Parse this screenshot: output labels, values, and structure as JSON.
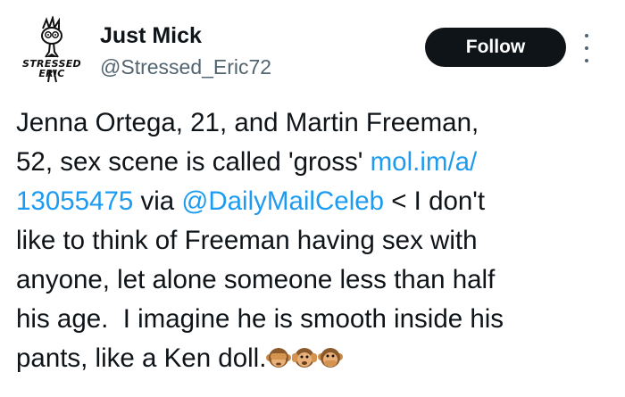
{
  "user": {
    "display_name": "Just Mick",
    "handle": "@Stressed_Eric72",
    "avatar_text_line1": "STRESSED",
    "avatar_text_line2": "ERIC"
  },
  "actions": {
    "follow_label": "Follow"
  },
  "tweet": {
    "segments": [
      {
        "type": "text",
        "value": "Jenna Ortega, 21, and Martin Freeman,\n52, sex scene is called 'gross' "
      },
      {
        "type": "link",
        "value": "mol.im/a/\n13055475"
      },
      {
        "type": "text",
        "value": " via "
      },
      {
        "type": "link",
        "value": "@DailyMailCeleb"
      },
      {
        "type": "text",
        "value": " < I don't\nlike to think of Freeman having sex with\nanyone, let alone someone less than half\nhis age.  I imagine he is smooth inside his\npants, like a Ken doll."
      }
    ],
    "emojis": [
      "see-no-evil-monkey-icon",
      "hear-no-evil-monkey-icon",
      "speak-no-evil-monkey-icon"
    ]
  },
  "colors": {
    "link": "#1d9bf0",
    "handle": "#536471",
    "text": "#0f1419",
    "follow_bg": "#0f1419"
  }
}
